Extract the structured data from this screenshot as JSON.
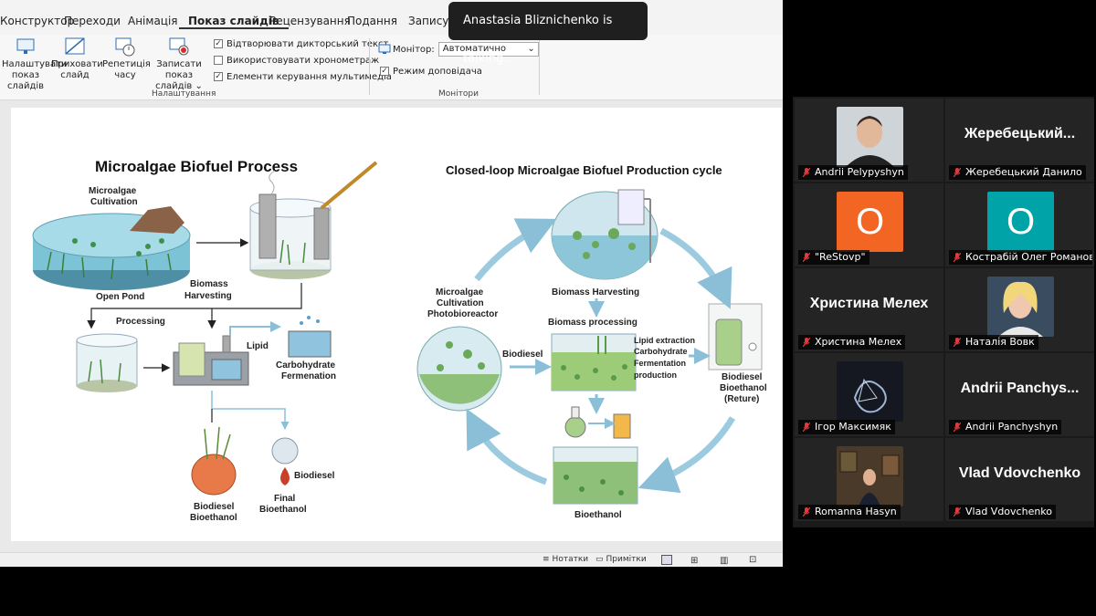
{
  "ribbon": {
    "tabs": [
      {
        "label": "Конструктор",
        "active": false
      },
      {
        "label": "Переходи",
        "active": false
      },
      {
        "label": "Анімація",
        "active": false
      },
      {
        "label": "Показ слайдів",
        "active": true
      },
      {
        "label": "Рецензування",
        "active": false
      },
      {
        "label": "Подання",
        "active": false
      },
      {
        "label": "Записування",
        "active": false
      }
    ],
    "buttons": {
      "setup_show": "Налаштувати показ слайдів",
      "hide_slide": "Приховати слайд",
      "rehearse": "Репетиція часу",
      "record": "Записати показ слайдів"
    },
    "checkboxes": [
      "Відтворювати дикторський текст",
      "Використовувати хронометраж",
      "Елементи керування мультимедіа"
    ],
    "group_setup_label": "Налаштування",
    "monitor_label": "Монітор:",
    "monitor_value": "Автоматично",
    "presenter_view": "Режим доповідача",
    "group_monitors_label": "Монітори"
  },
  "toast": {
    "text": "Anastasia Bliznichenko is talking..."
  },
  "slide": {
    "left_title": "Microalgae Biofuel Process",
    "left_labels": {
      "cultivation": [
        "Microalgae",
        "Cultivation"
      ],
      "open_pond": "Open Pond",
      "harvesting": [
        "Biomass",
        "Harvesting"
      ],
      "processing": "Processing",
      "lipid": "Lipid",
      "carbohydrate": [
        "Carbohydrate",
        "Fermenation"
      ],
      "biodiesel_bioethanol": [
        "Biodiesel",
        "Bioethanol"
      ],
      "biodiesel": "Biodiesel",
      "final_bioethanol": [
        "Final",
        "Bioethanol"
      ]
    },
    "right_title": "Closed-loop Microalgae  Biofuel Production cycle",
    "right_labels": {
      "photobioreactor": [
        "Microalgae",
        "Cultivation",
        "Photobioreactor"
      ],
      "biomass_harvesting": "Biomass Harvesting",
      "biomass_processing": "Biomass processing",
      "biodiesel": "Biodiesel",
      "extraction": [
        "Lipid extraction",
        "Carbohydrate",
        "Fermentation",
        "production"
      ],
      "biodiesel_bioethanol_return": [
        "Biodiesel",
        "Bioethanol",
        "(Reture)"
      ],
      "bioethanol": "Bioethanol"
    }
  },
  "statusbar": {
    "notes": "Нотатки",
    "comments": "Примітки"
  },
  "participants": [
    {
      "name": "Andrii Pelypyshyn",
      "type": "photo",
      "photo": "man",
      "muted": true
    },
    {
      "name": "Жеребецький Данило",
      "type": "text",
      "big": "Жеребецький...",
      "muted": true
    },
    {
      "name": "\"ReStovp\"",
      "type": "avatar",
      "letter": "O",
      "color": "#f26522",
      "muted": true
    },
    {
      "name": "Кострабій Олег Романов...",
      "type": "avatar",
      "letter": "O",
      "color": "#00a3a8",
      "muted": true
    },
    {
      "name": "Христина Мелех",
      "type": "text",
      "big": "Христина Мелех",
      "muted": true
    },
    {
      "name": "Наталія Вовк",
      "type": "photo",
      "photo": "woman",
      "muted": true
    },
    {
      "name": "Ігор Максимяк",
      "type": "photo",
      "photo": "art",
      "muted": true
    },
    {
      "name": "Andrii Panchyshyn",
      "type": "text",
      "big": "Andrii  Panchys...",
      "muted": true
    },
    {
      "name": "Romanna Hasyn",
      "type": "photo",
      "photo": "room",
      "muted": true
    },
    {
      "name": "Vlad Vdovchenko",
      "type": "text",
      "big": "Vlad Vdovchenko",
      "muted": true
    }
  ],
  "colors": {
    "pond": "#6fb7c9",
    "green": "#7fb35a",
    "arrow": "#9ccbe0",
    "mute": "#e03b3b"
  }
}
